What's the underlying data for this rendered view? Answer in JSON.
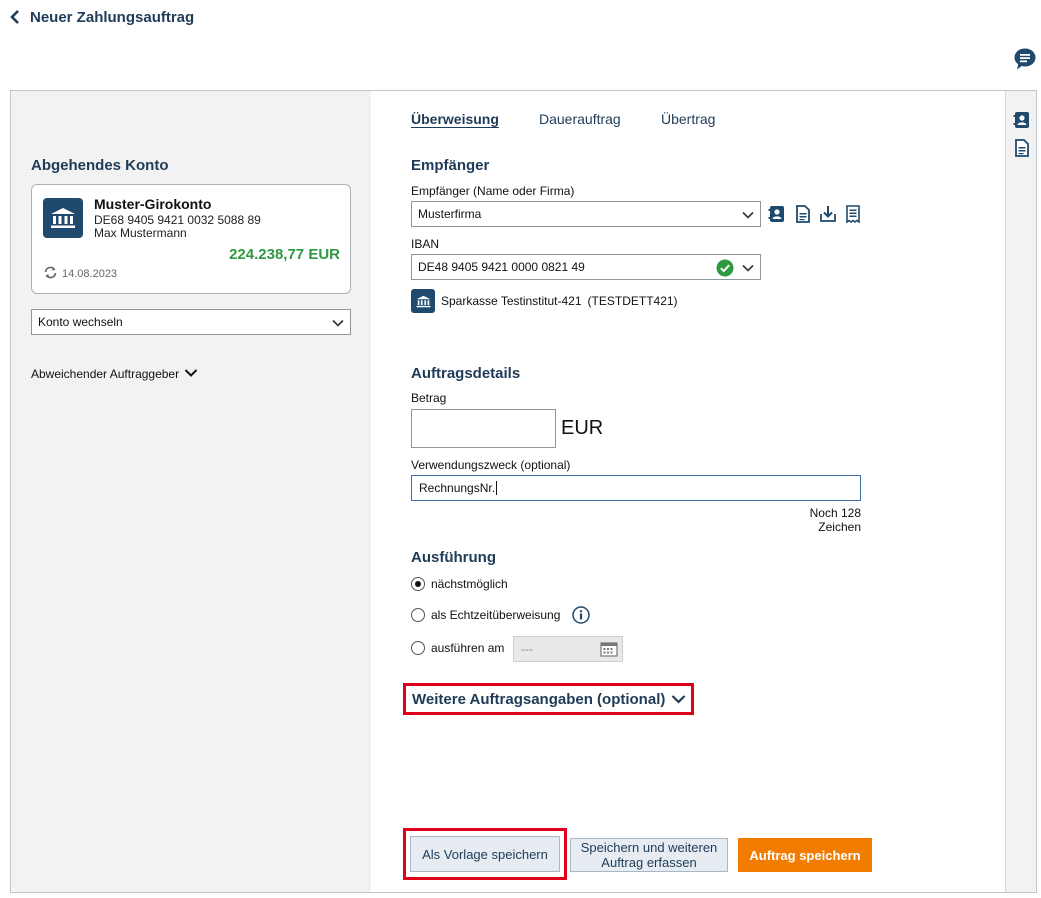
{
  "header": {
    "title": "Neuer Zahlungsauftrag"
  },
  "icons": {
    "back": "chevron-left-icon",
    "chat": "chat-bubble-icon",
    "bank": "bank-building-icon",
    "sync": "refresh-icon",
    "check": "check-circle-icon",
    "info": "info-icon",
    "calendar": "calendar-icon",
    "contact": "contact-book-icon",
    "template": "document-icon",
    "import": "download-icon",
    "receipt": "receipt-icon"
  },
  "colors": {
    "brand": "#1f3b57",
    "accent": "#f27c00",
    "success": "#2e9a3f",
    "highlight": "#e0001b"
  },
  "left": {
    "heading": "Abgehendes Konto",
    "account": {
      "name": "Muster-Girokonto",
      "iban": "DE68 9405 9421 0032 5088 89",
      "owner": "Max Mustermann",
      "balance": "224.238,77 EUR",
      "date": "14.08.2023"
    },
    "switch_label": "Konto wechseln",
    "different_payer": "Abweichender Auftraggeber"
  },
  "tabs": [
    {
      "label": "Überweisung",
      "active": true
    },
    {
      "label": "Dauerauftrag",
      "active": false
    },
    {
      "label": "Übertrag",
      "active": false
    }
  ],
  "recipient": {
    "title": "Empfänger",
    "name_label": "Empfänger (Name oder Firma)",
    "name_value": "Musterfirma",
    "iban_label": "IBAN",
    "iban_value": "DE48 9405 9421 0000 0821 49",
    "bank_name": "Sparkasse Testinstitut-421",
    "bic": "(TESTDETT421)"
  },
  "details": {
    "title": "Auftragsdetails",
    "amount_label": "Betrag",
    "amount_value": "",
    "currency": "EUR",
    "purpose_label": "Verwendungszweck (optional)",
    "purpose_value": "RechnungsNr.",
    "remaining": "Noch 128 Zeichen"
  },
  "execution": {
    "title": "Ausführung",
    "options": [
      {
        "label": "nächstmöglich",
        "checked": true
      },
      {
        "label": "als Echtzeitüberweisung",
        "checked": false
      },
      {
        "label": "ausführen am",
        "checked": false
      }
    ],
    "date_placeholder": "---"
  },
  "more_details": "Weitere Auftragsangaben (optional)",
  "buttons": {
    "template": "Als Vorlage speichern",
    "save_more": "Speichern und weiteren Auftrag erfassen",
    "save": "Auftrag speichern"
  }
}
